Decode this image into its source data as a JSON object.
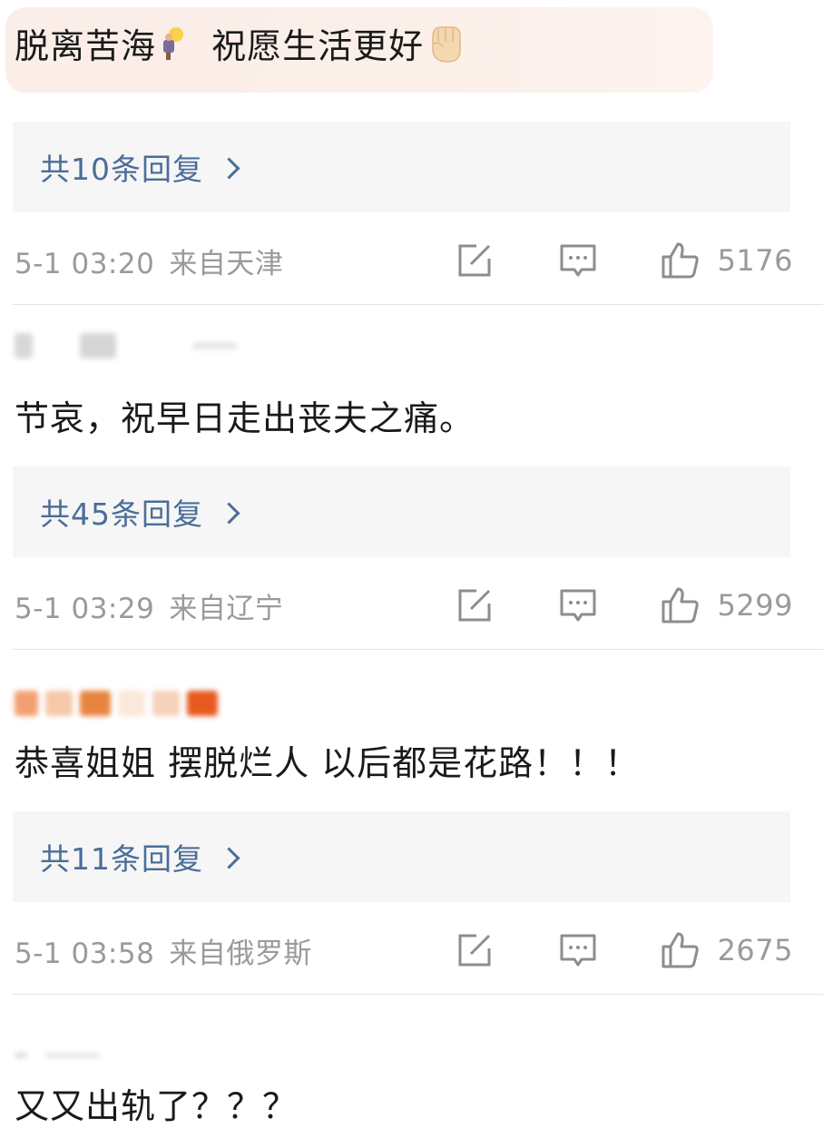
{
  "comments": [
    {
      "text": "脱离苦海",
      "text2": "祝愿生活更好",
      "reply_label": "共10条回复",
      "time": "5-1 03:20",
      "location": "来自天津",
      "likes": "5176"
    },
    {
      "text": "节哀，祝早日走出丧夫之痛。",
      "reply_label": "共45条回复",
      "time": "5-1 03:29",
      "location": "来自辽宁",
      "likes": "5299"
    },
    {
      "text": "恭喜姐姐 摆脱烂人 以后都是花路！！！",
      "reply_label": "共11条回复",
      "time": "5-1 03:58",
      "location": "来自俄罗斯",
      "likes": "2675"
    },
    {
      "text": "又又出轨了？？？"
    }
  ],
  "icons": {
    "share": "share-edit-icon",
    "comment": "comment-bubble-icon",
    "like": "thumbs-up-icon",
    "bulb": "lightbulb-emoji-icon",
    "fist": "raised-fist-emoji-icon"
  },
  "colors": {
    "reply_link": "#4b6d99",
    "meta_text": "#9a9a9a",
    "reply_box_bg": "#f6f6f6"
  }
}
